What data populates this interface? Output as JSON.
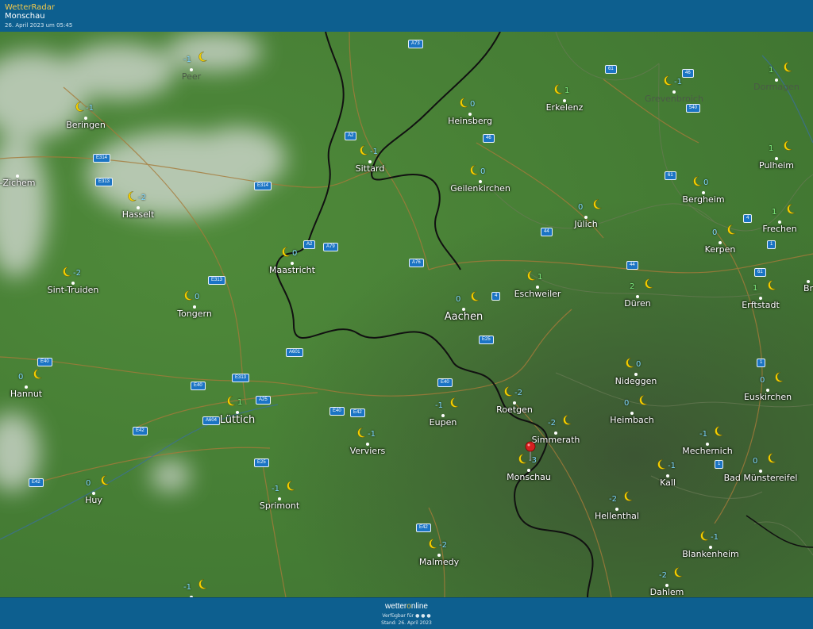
{
  "header": {
    "brand": "WetterRadar",
    "location": "Monschau",
    "timestamp": "26. April 2023 um 05:45"
  },
  "footer": {
    "logo_a": "wetter",
    "logo_o": "o",
    "logo_b": "nline",
    "available": "Verfügbar für",
    "status": "Stand: 26. April 2023"
  },
  "colors": {
    "bar": "#0d5f8f",
    "moon": "#f5d000",
    "temp": "#7fd8ff",
    "road_badge": "#1b74c4"
  },
  "stations": [
    {
      "name": "Peer",
      "temp": "-1",
      "muted": true
    },
    {
      "name": "Beringen",
      "temp": "-1"
    },
    {
      "name": "-Zichem",
      "temp": ""
    },
    {
      "name": "Hasselt",
      "temp": "-2"
    },
    {
      "name": "Sint-Truiden",
      "temp": "-2"
    },
    {
      "name": "Tongern",
      "temp": "0"
    },
    {
      "name": "Maastricht",
      "temp": "0"
    },
    {
      "name": "Sittard",
      "temp": "-1"
    },
    {
      "name": "Heinsberg",
      "temp": "0"
    },
    {
      "name": "Erkelenz",
      "temp": "1"
    },
    {
      "name": "Grevenbroich",
      "temp": "-1",
      "muted": true
    },
    {
      "name": "Dormagen",
      "temp": "1",
      "muted": true
    },
    {
      "name": "Geilenkirchen",
      "temp": "0"
    },
    {
      "name": "Pulheim",
      "temp": "1"
    },
    {
      "name": "Bergheim",
      "temp": "0"
    },
    {
      "name": "Jülich",
      "temp": "0"
    },
    {
      "name": "Frechen",
      "temp": "1"
    },
    {
      "name": "Kerpen",
      "temp": "0"
    },
    {
      "name": "Eschweiler",
      "temp": "1"
    },
    {
      "name": "Aachen",
      "temp": "0",
      "big": true
    },
    {
      "name": "Düren",
      "temp": "2"
    },
    {
      "name": "Erftstadt",
      "temp": "1"
    },
    {
      "name": "Br",
      "temp": ""
    },
    {
      "name": "Hannut",
      "temp": "0"
    },
    {
      "name": "Lüttich",
      "temp": "1",
      "big": true
    },
    {
      "name": "Eupen",
      "temp": "-1"
    },
    {
      "name": "Roetgen",
      "temp": "-2"
    },
    {
      "name": "Nideggen",
      "temp": "0"
    },
    {
      "name": "Euskirchen",
      "temp": "0"
    },
    {
      "name": "Simmerath",
      "temp": "-2"
    },
    {
      "name": "Heimbach",
      "temp": "0"
    },
    {
      "name": "Verviers",
      "temp": "-1"
    },
    {
      "name": "Mechernich",
      "temp": "-1"
    },
    {
      "name": "Monschau",
      "temp": "-3"
    },
    {
      "name": "Kall",
      "temp": "-1"
    },
    {
      "name": "Bad Münstereifel",
      "temp": "0"
    },
    {
      "name": "Huy",
      "temp": "0"
    },
    {
      "name": "Sprimont",
      "temp": "-1"
    },
    {
      "name": "Hellenthal",
      "temp": "-2"
    },
    {
      "name": "Malmedy",
      "temp": "-2"
    },
    {
      "name": "Blankenheim",
      "temp": "-1"
    },
    {
      "name": "Dahlem",
      "temp": "-2"
    },
    {
      "name": "",
      "temp": "-1"
    }
  ],
  "roads": [
    "A73",
    "61",
    "46",
    "540",
    "A2",
    "E314",
    "E313",
    "E314",
    "46",
    "61",
    "A2",
    "A79",
    "44",
    "4",
    "A76",
    "1",
    "E313",
    "61",
    "4",
    "44",
    "E25",
    "A601",
    "E40",
    "E40",
    "1",
    "E313",
    "A25",
    "E40",
    "E40",
    "E42",
    "A604",
    "E42",
    "E25",
    "E42",
    "E42",
    "1"
  ]
}
